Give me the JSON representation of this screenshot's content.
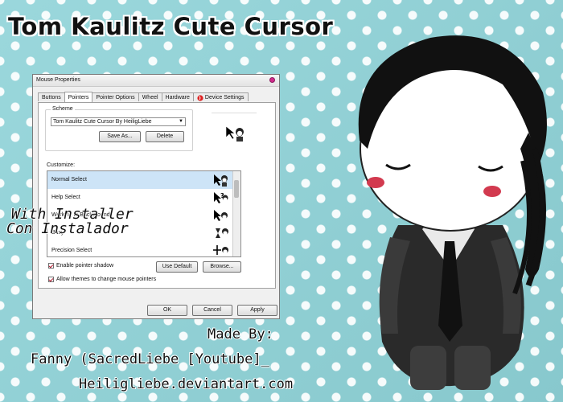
{
  "banner": {
    "title": "Tom Kaulitz Cute Cursor"
  },
  "dialog": {
    "title": "Mouse Properties",
    "tabs": [
      "Buttons",
      "Pointers",
      "Pointer Options",
      "Wheel",
      "Hardware",
      "Device Settings"
    ],
    "active_tab": "Pointers",
    "scheme": {
      "label": "Scheme",
      "selected": "Tom Kaulitz Cute Cursor By HeiligLiebe",
      "save_as": "Save As...",
      "delete": "Delete"
    },
    "customize_label": "Customize:",
    "list_items": [
      "Normal Select",
      "Help Select",
      "Working In Background",
      "Busy",
      "Precision Select"
    ],
    "selected_item": "Normal Select",
    "enable_shadow": "Enable pointer shadow",
    "use_default": "Use Default",
    "browse": "Browse...",
    "allow_themes": "Allow themes to change mouse pointers",
    "ok": "OK",
    "cancel": "Cancel",
    "apply": "Apply"
  },
  "overlay": {
    "line1": "With Installer",
    "line2": "Con Instalador"
  },
  "credits": {
    "line1": "Made By:",
    "line2": "Fanny (SacredLiebe [Youtube]_",
    "line3": "Heiligliebe.deviantart.com"
  },
  "colors": {
    "background": "#8fd3d8",
    "selection": "#cde4f7",
    "accent": "#d12a8c"
  }
}
